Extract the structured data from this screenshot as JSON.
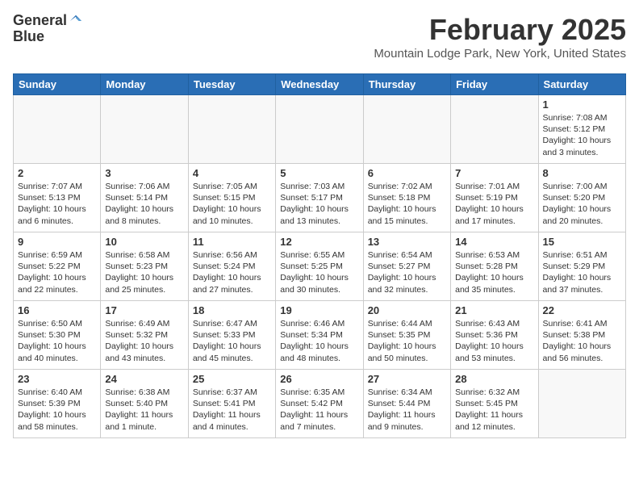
{
  "app": {
    "name_line1": "General",
    "name_line2": "Blue"
  },
  "header": {
    "month_year": "February 2025",
    "location": "Mountain Lodge Park, New York, United States"
  },
  "weekdays": [
    "Sunday",
    "Monday",
    "Tuesday",
    "Wednesday",
    "Thursday",
    "Friday",
    "Saturday"
  ],
  "weeks": [
    [
      {
        "day": "",
        "info": ""
      },
      {
        "day": "",
        "info": ""
      },
      {
        "day": "",
        "info": ""
      },
      {
        "day": "",
        "info": ""
      },
      {
        "day": "",
        "info": ""
      },
      {
        "day": "",
        "info": ""
      },
      {
        "day": "1",
        "info": "Sunrise: 7:08 AM\nSunset: 5:12 PM\nDaylight: 10 hours and 3 minutes."
      }
    ],
    [
      {
        "day": "2",
        "info": "Sunrise: 7:07 AM\nSunset: 5:13 PM\nDaylight: 10 hours and 6 minutes."
      },
      {
        "day": "3",
        "info": "Sunrise: 7:06 AM\nSunset: 5:14 PM\nDaylight: 10 hours and 8 minutes."
      },
      {
        "day": "4",
        "info": "Sunrise: 7:05 AM\nSunset: 5:15 PM\nDaylight: 10 hours and 10 minutes."
      },
      {
        "day": "5",
        "info": "Sunrise: 7:03 AM\nSunset: 5:17 PM\nDaylight: 10 hours and 13 minutes."
      },
      {
        "day": "6",
        "info": "Sunrise: 7:02 AM\nSunset: 5:18 PM\nDaylight: 10 hours and 15 minutes."
      },
      {
        "day": "7",
        "info": "Sunrise: 7:01 AM\nSunset: 5:19 PM\nDaylight: 10 hours and 17 minutes."
      },
      {
        "day": "8",
        "info": "Sunrise: 7:00 AM\nSunset: 5:20 PM\nDaylight: 10 hours and 20 minutes."
      }
    ],
    [
      {
        "day": "9",
        "info": "Sunrise: 6:59 AM\nSunset: 5:22 PM\nDaylight: 10 hours and 22 minutes."
      },
      {
        "day": "10",
        "info": "Sunrise: 6:58 AM\nSunset: 5:23 PM\nDaylight: 10 hours and 25 minutes."
      },
      {
        "day": "11",
        "info": "Sunrise: 6:56 AM\nSunset: 5:24 PM\nDaylight: 10 hours and 27 minutes."
      },
      {
        "day": "12",
        "info": "Sunrise: 6:55 AM\nSunset: 5:25 PM\nDaylight: 10 hours and 30 minutes."
      },
      {
        "day": "13",
        "info": "Sunrise: 6:54 AM\nSunset: 5:27 PM\nDaylight: 10 hours and 32 minutes."
      },
      {
        "day": "14",
        "info": "Sunrise: 6:53 AM\nSunset: 5:28 PM\nDaylight: 10 hours and 35 minutes."
      },
      {
        "day": "15",
        "info": "Sunrise: 6:51 AM\nSunset: 5:29 PM\nDaylight: 10 hours and 37 minutes."
      }
    ],
    [
      {
        "day": "16",
        "info": "Sunrise: 6:50 AM\nSunset: 5:30 PM\nDaylight: 10 hours and 40 minutes."
      },
      {
        "day": "17",
        "info": "Sunrise: 6:49 AM\nSunset: 5:32 PM\nDaylight: 10 hours and 43 minutes."
      },
      {
        "day": "18",
        "info": "Sunrise: 6:47 AM\nSunset: 5:33 PM\nDaylight: 10 hours and 45 minutes."
      },
      {
        "day": "19",
        "info": "Sunrise: 6:46 AM\nSunset: 5:34 PM\nDaylight: 10 hours and 48 minutes."
      },
      {
        "day": "20",
        "info": "Sunrise: 6:44 AM\nSunset: 5:35 PM\nDaylight: 10 hours and 50 minutes."
      },
      {
        "day": "21",
        "info": "Sunrise: 6:43 AM\nSunset: 5:36 PM\nDaylight: 10 hours and 53 minutes."
      },
      {
        "day": "22",
        "info": "Sunrise: 6:41 AM\nSunset: 5:38 PM\nDaylight: 10 hours and 56 minutes."
      }
    ],
    [
      {
        "day": "23",
        "info": "Sunrise: 6:40 AM\nSunset: 5:39 PM\nDaylight: 10 hours and 58 minutes."
      },
      {
        "day": "24",
        "info": "Sunrise: 6:38 AM\nSunset: 5:40 PM\nDaylight: 11 hours and 1 minute."
      },
      {
        "day": "25",
        "info": "Sunrise: 6:37 AM\nSunset: 5:41 PM\nDaylight: 11 hours and 4 minutes."
      },
      {
        "day": "26",
        "info": "Sunrise: 6:35 AM\nSunset: 5:42 PM\nDaylight: 11 hours and 7 minutes."
      },
      {
        "day": "27",
        "info": "Sunrise: 6:34 AM\nSunset: 5:44 PM\nDaylight: 11 hours and 9 minutes."
      },
      {
        "day": "28",
        "info": "Sunrise: 6:32 AM\nSunset: 5:45 PM\nDaylight: 11 hours and 12 minutes."
      },
      {
        "day": "",
        "info": ""
      }
    ]
  ]
}
